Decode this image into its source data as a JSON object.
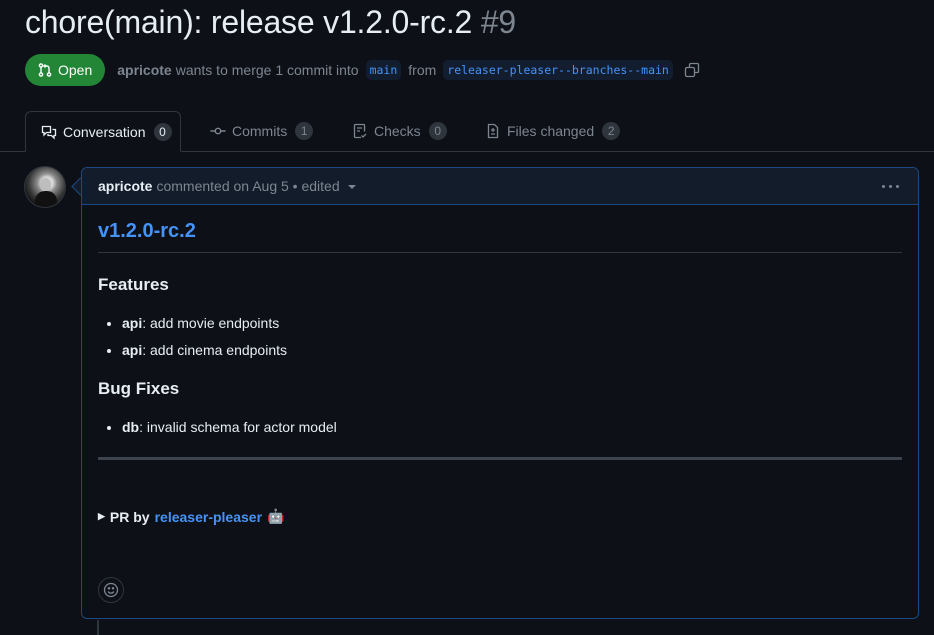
{
  "pr": {
    "title": "chore(main): release v1.2.0-rc.2",
    "number": "#9",
    "state": "Open",
    "author": "apricote",
    "merge_text": "wants to merge 1 commit into",
    "base_branch": "main",
    "from_text": "from",
    "head_branch": "releaser-pleaser--branches--main"
  },
  "tabs": [
    {
      "label": "Conversation",
      "count": "0",
      "icon": "comment-discussion-icon",
      "active": true
    },
    {
      "label": "Commits",
      "count": "1",
      "icon": "git-commit-icon",
      "active": false
    },
    {
      "label": "Checks",
      "count": "0",
      "icon": "checklist-icon",
      "active": false
    },
    {
      "label": "Files changed",
      "count": "2",
      "icon": "file-diff-icon",
      "active": false
    }
  ],
  "comment": {
    "author": "apricote",
    "meta": "commented on Aug 5 • edited",
    "heading": "v1.2.0-rc.2",
    "sections": [
      {
        "title": "Features",
        "items": [
          {
            "scope": "api",
            "text": ": add movie endpoints"
          },
          {
            "scope": "api",
            "text": ": add cinema endpoints"
          }
        ]
      },
      {
        "title": "Bug Fixes",
        "items": [
          {
            "scope": "db",
            "text": ": invalid schema for actor model"
          }
        ]
      }
    ],
    "details_prefix": "PR by",
    "details_link": "releaser-pleaser",
    "details_emoji": "🤖"
  }
}
